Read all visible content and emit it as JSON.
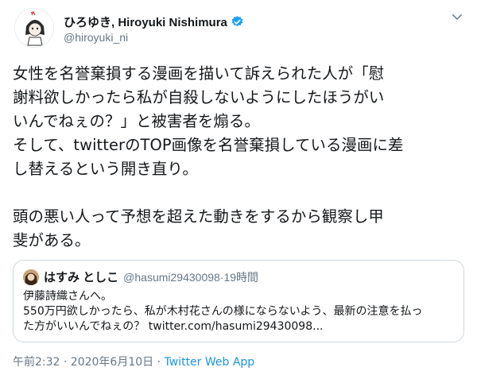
{
  "author": {
    "display_name": "ひろゆき, Hiroyuki Nishimura",
    "handle": "@hiroyuki_ni",
    "avatar_icon": "avatar-illustration-icon",
    "verified_icon": "verified-badge-icon"
  },
  "tweet": {
    "lines": [
      "女性を名誉棄損する漫画を描いて訴えられた人が「慰",
      "謝料欲しかったら私が自殺しないようにしたほうがい",
      "いんでねぇの？」と被害者を煽る。",
      "そして、twitterのTOP画像を名誉棄損している漫画に差",
      "し替えるという開き直り。",
      "",
      "頭の悪い人って予想を超えた動きをするから観察し甲",
      "斐がある。"
    ]
  },
  "quote": {
    "name": "はすみ としこ",
    "handle": "@hasumi29430098",
    "separator": " · ",
    "time": "19時間",
    "lines": [
      "伊藤詩織さんへ。",
      "550万円欲しかったら、私が木村花さんの様にならないよう、最新の注意を払っ",
      "た方がいいんでねぇの？ twitter.com/hasumi29430098..."
    ]
  },
  "footer": {
    "timestamp": "午前2:32 · 2020年6月10日",
    "separator": " · ",
    "source": "Twitter Web App"
  },
  "colors": {
    "verified": "#1da1f2",
    "link": "#1b95e0",
    "secondary_text": "#657786",
    "border": "#cfd9de"
  }
}
